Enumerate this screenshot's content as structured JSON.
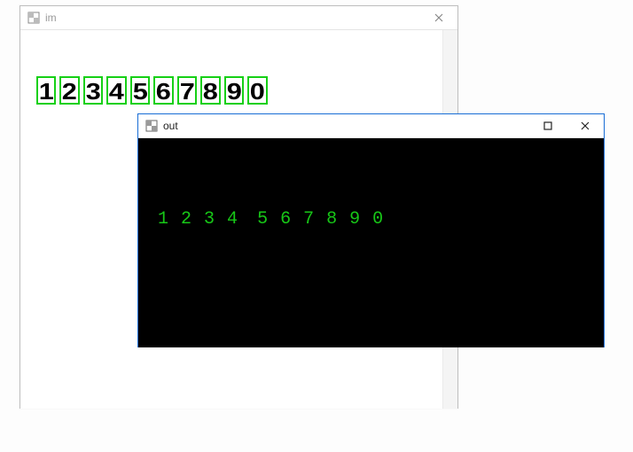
{
  "windows": {
    "im": {
      "title": "im",
      "digits": [
        "1",
        "2",
        "3",
        "4",
        "5",
        "6",
        "7",
        "8",
        "9",
        "0"
      ],
      "box_color": "#16d016",
      "text_color": "#000000",
      "active": false
    },
    "out": {
      "title": "out",
      "digits": [
        "1",
        "2",
        "3",
        "4",
        "5",
        "6",
        "7",
        "8",
        "9",
        "0"
      ],
      "text_color": "#17c717",
      "bg_color": "#000000",
      "active": true
    }
  },
  "controls": {
    "maximize_glyph": "▢",
    "close_glyph": "✕"
  }
}
